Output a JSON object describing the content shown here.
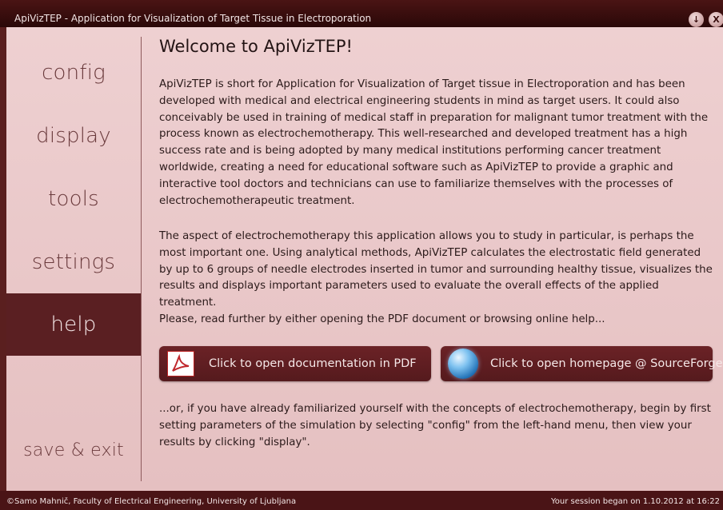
{
  "window": {
    "title": "ApiVizTEP - Application for Visualization of Target Tissue in Electroporation",
    "minimize_label": "↓",
    "close_label": "X"
  },
  "sidebar": {
    "items": [
      {
        "label": "config",
        "active": false
      },
      {
        "label": "display",
        "active": false
      },
      {
        "label": "tools",
        "active": false
      },
      {
        "label": "settings",
        "active": false
      },
      {
        "label": "help",
        "active": true
      },
      {
        "label": "save & exit",
        "active": false
      }
    ]
  },
  "main": {
    "heading": "Welcome to ApiVizTEP!",
    "paragraph1": "ApiVizTEP is short for Application for Visualization of Target tissue in Electroporation and has been developed with medical and electrical engineering students in mind as target users. It could also conceivably be used in training of medical staff in preparation for malignant tumor treatment with the process known as electrochemotherapy. This well-researched and developed treatment has a high success rate and is being adopted by many medical institutions performing cancer treatment worldwide, creating a need for educational software such as ApiVizTEP to provide a graphic and interactive tool doctors and technicians can use to familiarize themselves with the processes of electrochemotherapeutic treatment.",
    "paragraph2": "The aspect of electrochemotherapy this application allows you to study in particular, is perhaps the most important one. Using analytical methods, ApiVizTEP calculates the electrostatic field generated by up to 6 groups of needle electrodes inserted in tumor and surrounding healthy tissue, visualizes the results and displays important parameters used to evaluate the overall effects of the applied treatment.",
    "paragraph3": "Please, read further by either opening the PDF document or browsing online help...",
    "pdf_button": "Click to open documentation in PDF",
    "homepage_button": "Click to open homepage @ SourceForge",
    "paragraph4": "...or, if you have already familiarized yourself with the concepts of electrochemotherapy, begin by first setting parameters of the simulation by selecting \"config\" from the left-hand menu, then view your results by clicking \"display\"."
  },
  "status": {
    "left": "©Samo Mahnič, Faculty of Electrical Engineering, University of Ljubljana",
    "right": "Your session began on 1.10.2012 at 16:22"
  },
  "colors": {
    "accent": "#5a1f22",
    "background": "#e9c6c7",
    "titlebar": "#3a0d0d"
  }
}
